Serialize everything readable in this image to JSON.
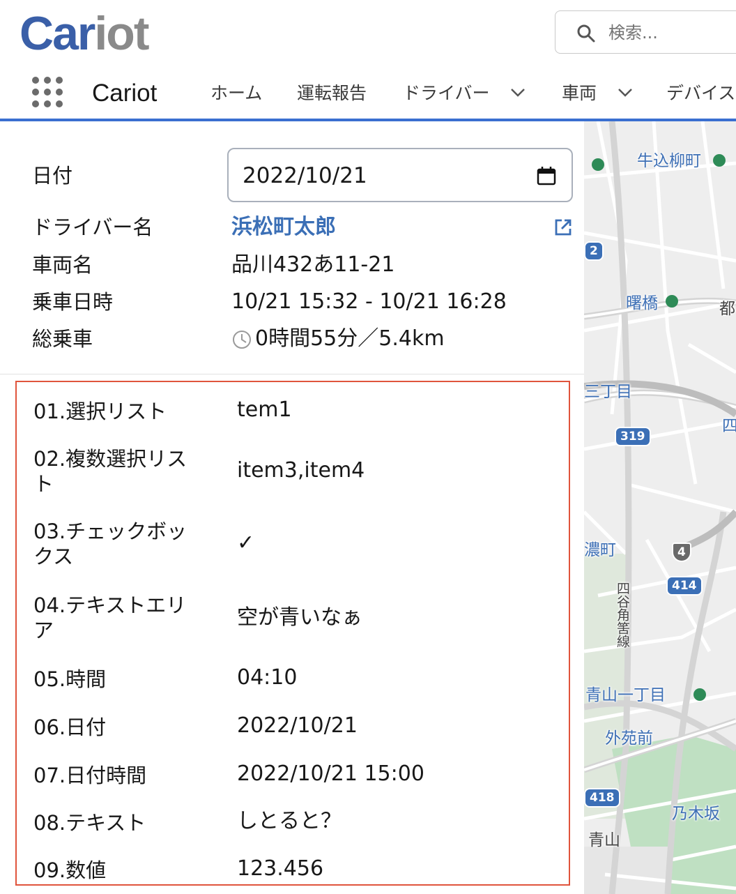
{
  "header": {
    "logo_part1": "Car",
    "logo_part2": "iot",
    "search_placeholder": "検索...",
    "app_name": "Cariot",
    "nav_items": [
      "ホーム",
      "運転報告",
      "ドライバー",
      "車両",
      "デバイス"
    ]
  },
  "colors": {
    "brand_blue": "#3a5fa8",
    "nav_accent": "#3a6fd0",
    "link_blue": "#3b6fb6",
    "highlight_border": "#e0543c"
  },
  "summary": {
    "date_label": "日付",
    "date_value": "2022/10/21",
    "driver_label": "ドライバー名",
    "driver_value": "浜松町太郎",
    "vehicle_label": "車両名",
    "vehicle_value": "品川432あ11-21",
    "ride_time_label": "乗車日時",
    "ride_time_value": "10/21 15:32 - 10/21 16:28",
    "total_label": "総乗車",
    "total_value": "0時間55分／5.4km"
  },
  "fields": [
    {
      "label": "01.選択リスト",
      "value": "tem1"
    },
    {
      "label": "02.複数選択リスト",
      "value": "item3,item4"
    },
    {
      "label": "03.チェックボックス",
      "value": "✓"
    },
    {
      "label": "04.テキストエリア",
      "value": "空が青いなぁ"
    },
    {
      "label": "05.時間",
      "value": "04:10"
    },
    {
      "label": "06.日付",
      "value": "2022/10/21"
    },
    {
      "label": "07.日付時間",
      "value": "2022/10/21 15:00"
    },
    {
      "label": "08.テキスト",
      "value": "しとると？"
    },
    {
      "label": "09.数値",
      "value": "123.456"
    }
  ],
  "map": {
    "labels": [
      "牛込柳町",
      "曙橋",
      "都",
      "三丁目",
      "四",
      "濃町",
      "四谷角筈線",
      "青山一丁目",
      "外苑前",
      "乃木坂",
      "青山"
    ],
    "route_shields": [
      "319",
      "4",
      "414",
      "418",
      "2"
    ]
  }
}
